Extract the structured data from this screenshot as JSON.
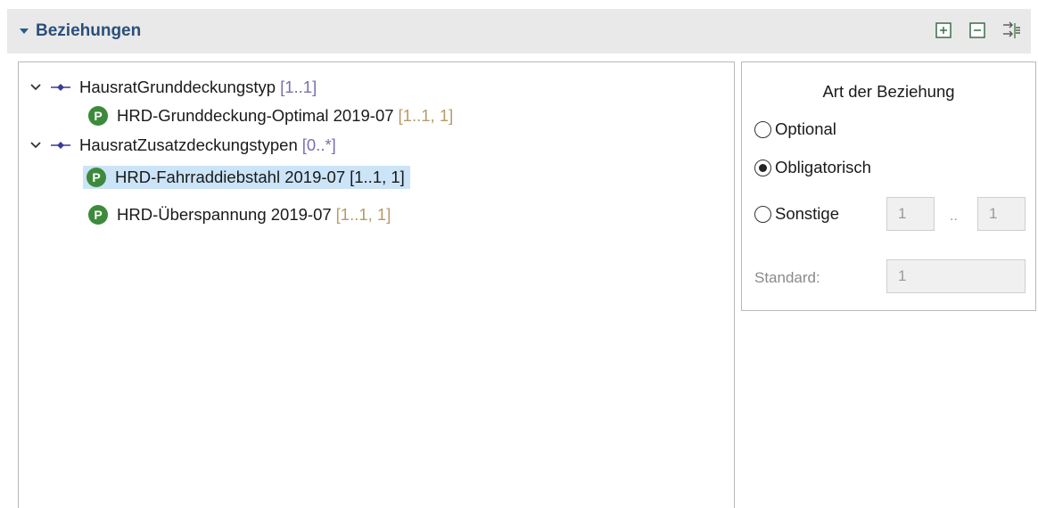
{
  "header": {
    "title": "Beziehungen",
    "tools": [
      {
        "icon": "expand-all-icon"
      },
      {
        "icon": "collapse-all-icon"
      },
      {
        "icon": "filter-lines-icon"
      }
    ]
  },
  "tree": {
    "nodes": [
      {
        "label": "HausratGrunddeckungstyp",
        "card": "[1..1]"
      },
      {
        "label": "HRD-Grunddeckung-Optimal 2019-07",
        "card": "[1..1, 1]"
      },
      {
        "label": "HausratZusatzdeckungstypen",
        "card": "[0..*]"
      },
      {
        "label": "HRD-Fahrraddiebstahl 2019-07",
        "card": "[1..1, 1]"
      },
      {
        "label": "HRD-Überspannung 2019-07",
        "card": "[1..1, 1]"
      }
    ]
  },
  "relation": {
    "title": "Art der Beziehung",
    "options": [
      {
        "label": "Optional"
      },
      {
        "label": "Obligatorisch"
      },
      {
        "label": "Sonstige"
      }
    ],
    "min_value": "1",
    "range_separator": "..",
    "max_value": "1",
    "standard_label": "Standard:",
    "standard_value": "1"
  }
}
